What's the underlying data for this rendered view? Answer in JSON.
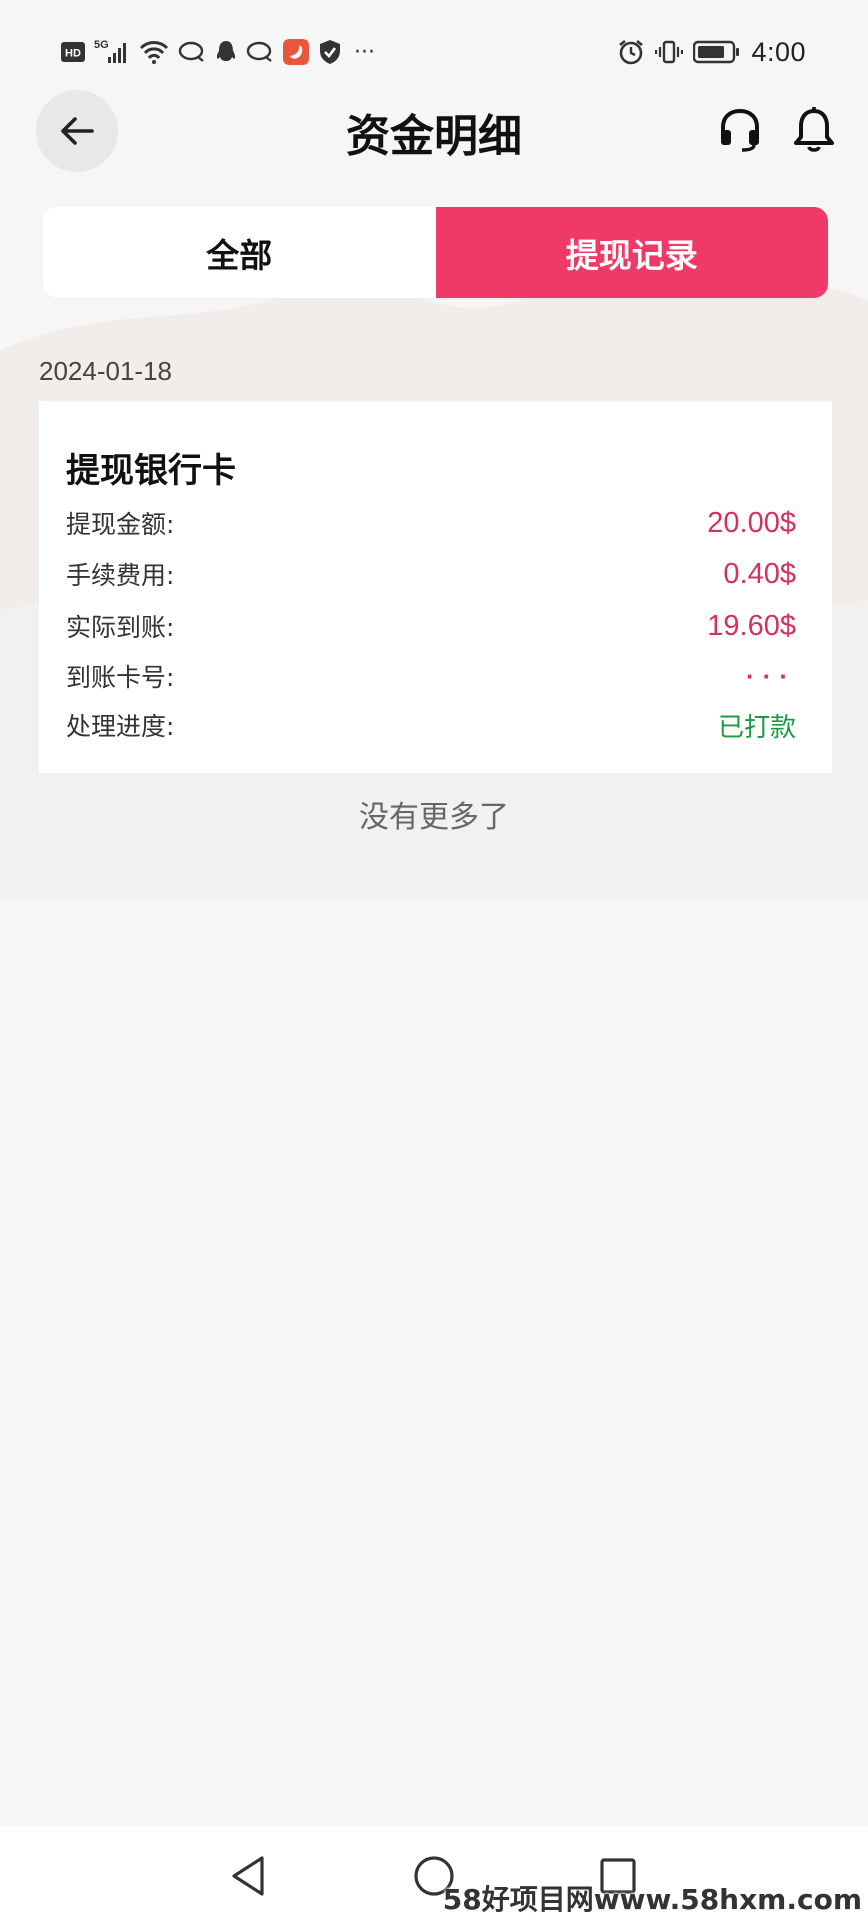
{
  "status_bar": {
    "time": "4:00",
    "network": "5G",
    "hd_badge": "HD",
    "overflow": "···",
    "icons": [
      "hd-icon",
      "signal-icon",
      "wifi-icon",
      "message-icon",
      "qq-icon",
      "message-icon",
      "app-icon",
      "shield-icon",
      "alarm-icon",
      "vibrate-icon",
      "battery-icon"
    ]
  },
  "header": {
    "title": "资金明细",
    "back_icon": "arrow-left-icon",
    "support_icon": "headset-icon",
    "notification_icon": "bell-icon"
  },
  "tabs": [
    {
      "label": "全部",
      "active": false
    },
    {
      "label": "提现记录",
      "active": true
    }
  ],
  "colors": {
    "accent": "#ef3a67",
    "amount": "#d4325e",
    "status_success": "#1c9a44"
  },
  "records": [
    {
      "date": "2024-01-18",
      "title": "提现银行卡",
      "rows": [
        {
          "label": "提现金额:",
          "value": "20.00$"
        },
        {
          "label": "手续费用:",
          "value": "0.40$"
        },
        {
          "label": "实际到账:",
          "value": "19.60$"
        },
        {
          "label": "到账卡号:",
          "value": "···"
        },
        {
          "label": "处理进度:",
          "value": "已打款"
        }
      ]
    }
  ],
  "footer_text": "没有更多了",
  "nav_bar": {
    "buttons": [
      "back-triangle-icon",
      "home-circle-icon",
      "recents-square-icon"
    ]
  },
  "watermark": "58好项目网www.58hxm.com"
}
